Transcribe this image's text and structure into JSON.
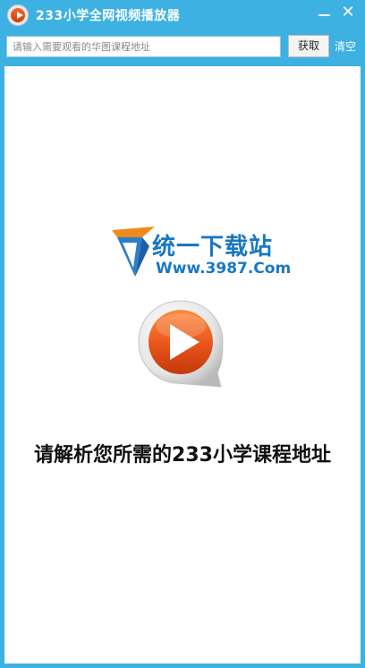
{
  "window": {
    "title": "233小学全网视频播放器",
    "accent_color": "#3db1e2"
  },
  "titlebar": {
    "app_icon": "play-icon",
    "minimize_icon": "minimize-icon",
    "close_icon": "close-icon",
    "close_glyph": "✕"
  },
  "toolbar": {
    "url_placeholder": "请输入需要观看的华图课程地址",
    "url_value": "",
    "fetch_label": "获取",
    "clear_label": "清空"
  },
  "content": {
    "logo": {
      "title": "统一下载站",
      "url": "Www.3987.Com",
      "color": "#1a78c2"
    },
    "play_icon": "play-icon",
    "play_color": "#e8531a",
    "prompt": "请解析您所需的233小学课程地址"
  }
}
